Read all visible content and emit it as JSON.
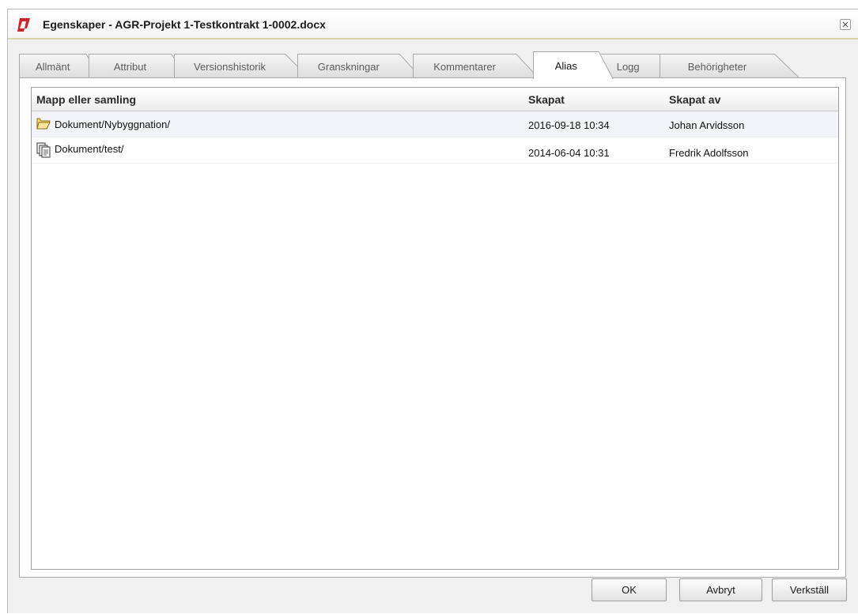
{
  "window": {
    "title": "Egenskaper - AGR-Projekt 1-Testkontrakt 1-0002.docx",
    "accent_color": "#c8262c"
  },
  "tabs": [
    {
      "label": "Allmänt",
      "active": false
    },
    {
      "label": "Attribut",
      "active": false
    },
    {
      "label": "Versionshistorik",
      "active": false
    },
    {
      "label": "Granskningar",
      "active": false
    },
    {
      "label": "Kommentarer",
      "active": false
    },
    {
      "label": "Alias",
      "active": true
    },
    {
      "label": "Logg",
      "active": false
    },
    {
      "label": "Behörigheter",
      "active": false
    }
  ],
  "table": {
    "columns": [
      "Mapp eller samling",
      "Skapat",
      "Skapat av"
    ],
    "rows": [
      {
        "icon": "folder-icon",
        "path": "Dokument/Nybyggnation/",
        "created": "2016-09-18 10:34",
        "created_by": "Johan Arvidsson"
      },
      {
        "icon": "collection-icon",
        "path": "Dokument/test/",
        "created": "2014-06-04 10:31",
        "created_by": "Fredrik Adolfsson"
      }
    ]
  },
  "buttons": {
    "ok": "OK",
    "cancel": "Avbryt",
    "apply": "Verkställ"
  }
}
